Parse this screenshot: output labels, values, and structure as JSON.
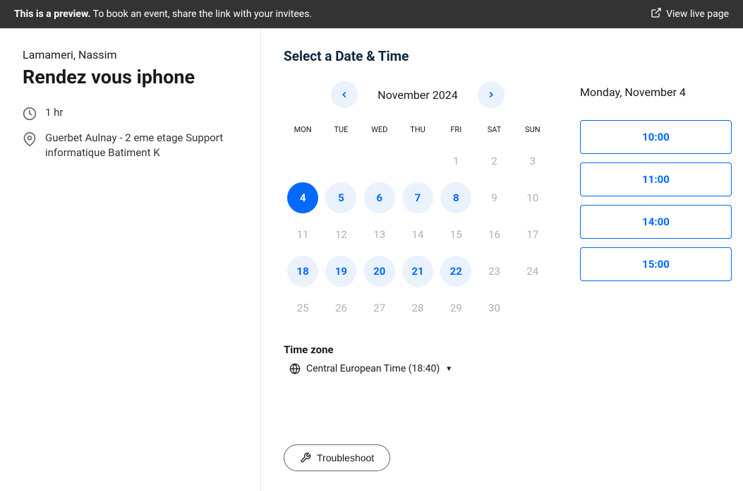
{
  "preview_bar": {
    "strong": "This is a preview.",
    "rest": " To book an event, share the link with your invitees.",
    "view_live": "View live page"
  },
  "event": {
    "host": "Lamameri, Nassim",
    "title": "Rendez vous iphone",
    "duration": "1 hr",
    "location": "Guerbet Aulnay - 2 eme etage Support informatique Batiment K"
  },
  "section_title": "Select a Date & Time",
  "calendar": {
    "month_label": "November 2024",
    "weekdays": [
      "MON",
      "TUE",
      "WED",
      "THU",
      "FRI",
      "SAT",
      "SUN"
    ],
    "days": [
      {
        "n": "",
        "state": "empty"
      },
      {
        "n": "",
        "state": "empty"
      },
      {
        "n": "",
        "state": "empty"
      },
      {
        "n": "",
        "state": "empty"
      },
      {
        "n": "1",
        "state": "disabled"
      },
      {
        "n": "2",
        "state": "disabled"
      },
      {
        "n": "3",
        "state": "disabled"
      },
      {
        "n": "4",
        "state": "selected"
      },
      {
        "n": "5",
        "state": "available"
      },
      {
        "n": "6",
        "state": "available"
      },
      {
        "n": "7",
        "state": "available"
      },
      {
        "n": "8",
        "state": "available"
      },
      {
        "n": "9",
        "state": "disabled"
      },
      {
        "n": "10",
        "state": "disabled"
      },
      {
        "n": "11",
        "state": "disabled"
      },
      {
        "n": "12",
        "state": "disabled"
      },
      {
        "n": "13",
        "state": "disabled"
      },
      {
        "n": "14",
        "state": "disabled"
      },
      {
        "n": "15",
        "state": "disabled"
      },
      {
        "n": "16",
        "state": "disabled"
      },
      {
        "n": "17",
        "state": "disabled"
      },
      {
        "n": "18",
        "state": "available"
      },
      {
        "n": "19",
        "state": "available"
      },
      {
        "n": "20",
        "state": "available"
      },
      {
        "n": "21",
        "state": "available"
      },
      {
        "n": "22",
        "state": "available"
      },
      {
        "n": "23",
        "state": "disabled"
      },
      {
        "n": "24",
        "state": "disabled"
      },
      {
        "n": "25",
        "state": "disabled"
      },
      {
        "n": "26",
        "state": "disabled"
      },
      {
        "n": "27",
        "state": "disabled"
      },
      {
        "n": "28",
        "state": "disabled"
      },
      {
        "n": "29",
        "state": "disabled"
      },
      {
        "n": "30",
        "state": "disabled"
      }
    ]
  },
  "timezone": {
    "heading": "Time zone",
    "label": "Central European Time (18:40)"
  },
  "times": {
    "selected_date": "Monday, November 4",
    "slots": [
      "10:00",
      "11:00",
      "14:00",
      "15:00"
    ]
  },
  "troubleshoot": {
    "label": "Troubleshoot"
  }
}
